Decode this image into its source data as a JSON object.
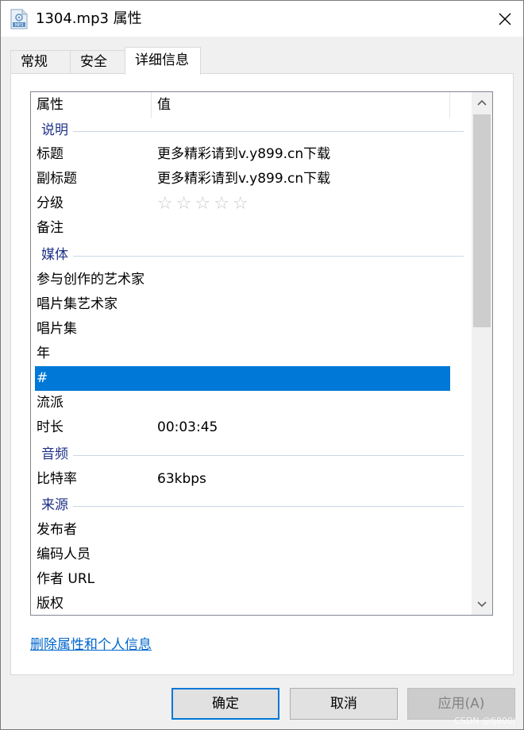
{
  "window": {
    "title": "1304.mp3 属性",
    "file_icon_label": "MP3"
  },
  "tabs": [
    {
      "label": "常规",
      "active": false
    },
    {
      "label": "安全",
      "active": false
    },
    {
      "label": "详细信息",
      "active": true
    }
  ],
  "list": {
    "columns": [
      "属性",
      "值"
    ],
    "groups": {
      "description": "说明",
      "media": "媒体",
      "audio": "音频",
      "origin": "来源"
    },
    "rows": {
      "title": {
        "key": "标题",
        "value": "更多精彩请到v.y899.cn下载"
      },
      "subtitle": {
        "key": "副标题",
        "value": "更多精彩请到v.y899.cn下载"
      },
      "rating": {
        "key": "分级",
        "stars": 5,
        "filled": 0
      },
      "comments": {
        "key": "备注",
        "value": ""
      },
      "contributing_artists": {
        "key": "参与创作的艺术家",
        "value": ""
      },
      "album_artist": {
        "key": "唱片集艺术家",
        "value": ""
      },
      "album": {
        "key": "唱片集",
        "value": ""
      },
      "year": {
        "key": "年",
        "value": ""
      },
      "track_number": {
        "key": "#",
        "value": "",
        "selected": true
      },
      "genre": {
        "key": "流派",
        "value": ""
      },
      "length": {
        "key": "时长",
        "value": "00:03:45"
      },
      "bitrate": {
        "key": "比特率",
        "value": "63kbps"
      },
      "publisher": {
        "key": "发布者",
        "value": ""
      },
      "encoded_by": {
        "key": "编码人员",
        "value": ""
      },
      "author_url": {
        "key": "作者 URL",
        "value": ""
      },
      "copyright": {
        "key": "版权",
        "value": ""
      }
    }
  },
  "links": {
    "remove_properties": "删除属性和个人信息"
  },
  "buttons": {
    "ok": "确定",
    "cancel": "取消",
    "apply": "应用(A)"
  },
  "watermark": "CSDN @fj800j",
  "colors": {
    "selection": "#0078d7",
    "group_text": "#1e3287",
    "link": "#0066cc"
  }
}
